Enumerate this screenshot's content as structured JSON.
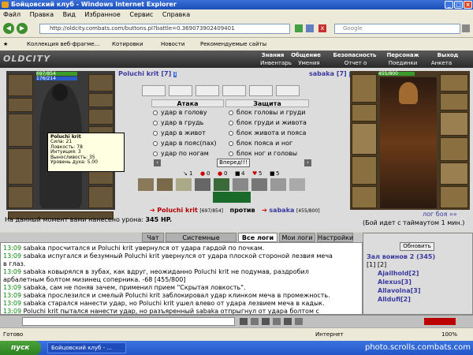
{
  "window": {
    "title": "Бойцовский клуб - Windows Internet Explorer"
  },
  "menu": [
    "Файл",
    "Правка",
    "Вид",
    "Избранное",
    "Сервис",
    "Справка"
  ],
  "address": {
    "url": "http://oldcity.combats.com/buttons.pl?battle=0.369073902409401",
    "search_placeholder": "Google"
  },
  "favorites": {
    "items": [
      "Коллекция веб-фрагме...",
      "Котировки",
      "Новости",
      "Рекомендуемые сайты"
    ]
  },
  "game_nav": {
    "top": [
      "Знания",
      "Общение",
      "Безопасность",
      "Персонаж",
      "Выход"
    ],
    "bottom": [
      "Инвентарь",
      "Умения",
      "Отчет о переводах",
      "Поединки",
      "Анкета"
    ]
  },
  "player": {
    "name": "Poluchi krit",
    "level": "[7]",
    "hp": "697/854",
    "mp": "176/214"
  },
  "opponent": {
    "name": "sabaka",
    "level": "[7]",
    "hp": "455/800"
  },
  "tooltip": {
    "name": "Poluchi krit",
    "lines": [
      "Сила: 21",
      "Ловкость: 78",
      "Интуиция: 3",
      "Выносливость: 35",
      "",
      "Уровень духа: 5.00"
    ]
  },
  "battle": {
    "attack_header": "Атака",
    "defense_header": "Защита",
    "attacks": [
      "удар в голову",
      "удар в грудь",
      "удар в живот",
      "удар в пояс(пах)",
      "удар по ногам"
    ],
    "defenses": [
      "блок головы и груди",
      "блок груди и живота",
      "блок живота и пояса",
      "блок пояса и ног",
      "блок ног и головы"
    ],
    "forward_button": "Вперед!!!",
    "stats_icons": [
      "1",
      "0",
      "0",
      "4",
      "5",
      "5"
    ],
    "player_hp": "[697/854]",
    "versus": "против",
    "opponent_hp": "[455/800]",
    "damage_text": "На данный момент вами нанесено урона:",
    "damage_value": "345 HP.",
    "log_link": "лог боя »»",
    "timeout_text": "(Бой идет с таймаутом 1 мин.)"
  },
  "chat": {
    "tabs": [
      "Чат",
      "Системные сообщения",
      "Все логи",
      "Мои логи",
      "Настройки"
    ],
    "lines": [
      {
        "time": "13:09",
        "text": "sabaka просчитался и Poluchi krit увернулся от удара гардой по почкам."
      },
      {
        "time": "13:09",
        "text": "sabaka испугался и безумный Poluchi krit увернулся от удара плоской стороной лезвия меча"
      },
      {
        "time": "",
        "text": "в глаз."
      },
      {
        "time": "13:09",
        "text": "sabaka ковырялся в зубах, как вдруг, неожиданно Poluchi krit не подумав, раздробил"
      },
      {
        "time": "",
        "text": "арбалетным болтом мизинец соперника. -68 [455/800]"
      },
      {
        "time": "13:09",
        "text": "sabaka, сам не поняв зачем, применил прием \"Скрытая ловкость\"."
      },
      {
        "time": "13:09",
        "text": "sabaka прослезился и смелый Poluchi krit заблокировал удар клинком меча в промежность."
      },
      {
        "time": "13:09",
        "text": "sabaka старался нанести удар, но Poluchi krit ушел влево от удара лезвием меча в кадык."
      },
      {
        "time": "13:09",
        "text": "Poluchi krit пытался нанести удар, но разъяренный sabaka отпрыгнул от удара болтом с"
      }
    ]
  },
  "roster": {
    "refresh_button": "Обновить",
    "title": "Зал воинов 2 (345)",
    "pages": "[1] [2]",
    "players": [
      "Ajailhold[2]",
      "Alexus[3]",
      "Allavolna[3]",
      "Alldufi[2]"
    ]
  },
  "statusbar": {
    "status": "Готово",
    "zone": "Интернет",
    "zoom": "100%"
  },
  "taskbar": {
    "start": "пуск",
    "item": "Бойцовский клуб - ...",
    "watermark": "photo.scrolls.combats.com"
  }
}
